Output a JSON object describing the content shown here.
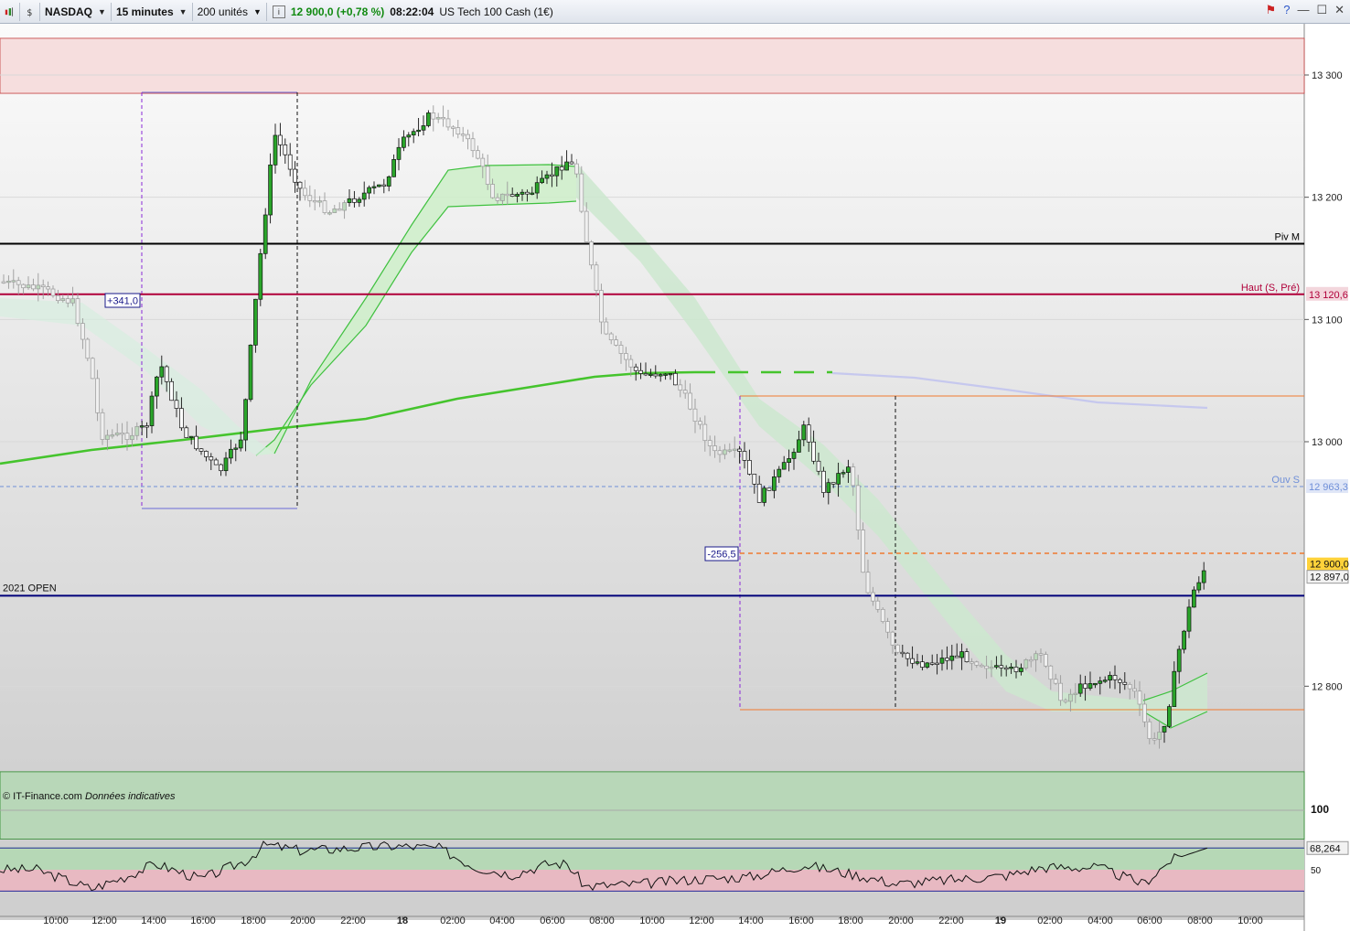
{
  "toolbar": {
    "symbol": "NASDAQ",
    "interval": "15 minutes",
    "units": "200 unités",
    "info_icon": "info-icon",
    "price_change": "12 900,0 (+0,78 %)",
    "time": "08:22:04",
    "instrument": "US Tech 100 Cash (1€)",
    "win_icons": [
      "alert-icon",
      "help-icon",
      "minimize-icon",
      "maximize-icon",
      "close-icon"
    ]
  },
  "chart_data": {
    "type": "candlestick",
    "ylim": [
      12710,
      13340
    ],
    "y_ticks": [
      "13 300",
      "13 200",
      "13 100",
      "13 000",
      "12 800"
    ],
    "x_ticks": [
      "10:00",
      "12:00",
      "14:00",
      "16:00",
      "18:00",
      "20:00",
      "22:00",
      "18",
      "02:00",
      "04:00",
      "06:00",
      "08:00",
      "10:00",
      "12:00",
      "14:00",
      "16:00",
      "18:00",
      "20:00",
      "22:00",
      "19",
      "02:00",
      "04:00",
      "06:00",
      "08:00",
      "10:00"
    ],
    "price_levels": [
      {
        "label": "Piv M",
        "value": 13162,
        "color": "#000000"
      },
      {
        "label": "Haut (S, Pré)",
        "price_label": "13 120,6",
        "value": 13120.6,
        "color": "#b0003a"
      },
      {
        "label": "Ouv S",
        "price_label": "12 963,3",
        "value": 12963.3,
        "color": "#6f8fd8"
      },
      {
        "label": "2021 OPEN",
        "value": 12874,
        "color": "#00007a"
      }
    ],
    "last_price": {
      "label": "12 900,0",
      "value": 12900.0
    },
    "bid_price": {
      "label": "12 897,0",
      "value": 12897.0
    },
    "measure_labels": [
      "+341,0",
      "-256,5"
    ],
    "zones": [
      {
        "name": "resistance",
        "from": 13285,
        "to": 13330,
        "color": "#f6dede"
      },
      {
        "name": "support",
        "from": 12675,
        "to": 12730,
        "color": "#b8d7b8"
      }
    ],
    "indicator": {
      "top_label": "100",
      "mid_label": "50",
      "value_label": "68,264",
      "value": 68.264
    },
    "watermark": {
      "source": "© IT-Finance.com",
      "note": "Données indicatives"
    }
  }
}
